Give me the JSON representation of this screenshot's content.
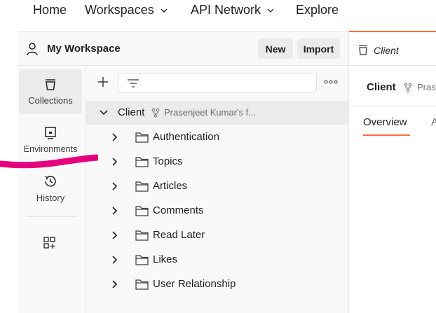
{
  "topnav": {
    "items": [
      {
        "label": "Home"
      },
      {
        "label": "Workspaces"
      },
      {
        "label": "API Network"
      },
      {
        "label": "Explore"
      }
    ]
  },
  "workspace": {
    "title": "My Workspace",
    "new_label": "New",
    "import_label": "Import"
  },
  "rail": {
    "items": [
      {
        "label": "Collections",
        "icon": "trash-can-like-collections-icon",
        "active": true
      },
      {
        "label": "Environments",
        "icon": "environment-icon"
      },
      {
        "label": "History",
        "icon": "history-icon"
      }
    ],
    "add_icon": "configure-workbench-icon"
  },
  "tree": {
    "collection": {
      "name": "Client",
      "owner": "Prasenjeet Kumar's f..."
    },
    "folders": [
      {
        "label": "Authentication"
      },
      {
        "label": "Topics"
      },
      {
        "label": "Articles"
      },
      {
        "label": "Comments"
      },
      {
        "label": "Read Later"
      },
      {
        "label": "Likes"
      },
      {
        "label": "User Relationship"
      }
    ]
  },
  "right": {
    "tab_name": "Client",
    "title": "Client",
    "owner": "Pras",
    "tabs": [
      {
        "label": "Overview"
      },
      {
        "label": "A"
      }
    ]
  },
  "colors": {
    "accent": "#ff6c37",
    "annotation": "#e6007e"
  }
}
